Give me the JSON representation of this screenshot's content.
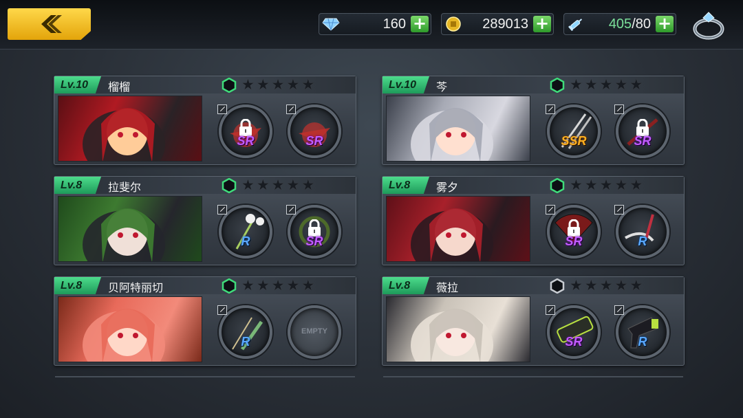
{
  "header": {
    "gems": "160",
    "gold": "289013",
    "stamina_current": "405",
    "stamina_max": "/80",
    "icons": {
      "back": "back-arrow-icon",
      "gems": "diamond-icon",
      "gold": "gold-coin-icon",
      "stamina": "syringe-icon",
      "settings": "ring-icon"
    }
  },
  "colors": {
    "accent_gold": "#f3c420",
    "level_green": "#3fcc80",
    "sr": "#c25cff",
    "ssr": "#ffb021",
    "r": "#5aa8ff"
  },
  "characters": [
    {
      "level": "Lv.10",
      "name": "榴榴",
      "grade_active": true,
      "stars": 5,
      "weapons": [
        {
          "rarity": "SR",
          "locked": true,
          "icon": "umbrella-icon"
        },
        {
          "rarity": "SR",
          "locked": false,
          "icon": "umbrella-icon"
        }
      ]
    },
    {
      "level": "Lv.10",
      "name": "芩",
      "grade_active": true,
      "stars": 5,
      "weapons": [
        {
          "rarity": "SSR",
          "locked": false,
          "icon": "twin-swords-icon"
        },
        {
          "rarity": "SR",
          "locked": true,
          "icon": "blade-icon"
        }
      ]
    },
    {
      "level": "Lv.8",
      "name": "拉斐尔",
      "grade_active": true,
      "stars": 5,
      "weapons": [
        {
          "rarity": "R",
          "locked": false,
          "icon": "flower-staff-icon"
        },
        {
          "rarity": "SR",
          "locked": true,
          "icon": "thorn-ring-icon"
        }
      ]
    },
    {
      "level": "Lv.8",
      "name": "雾夕",
      "grade_active": true,
      "stars": 5,
      "weapons": [
        {
          "rarity": "SR",
          "locked": true,
          "icon": "fan-icon"
        },
        {
          "rarity": "R",
          "locked": false,
          "icon": "chain-blade-icon"
        }
      ]
    },
    {
      "level": "Lv.8",
      "name": "贝阿特丽切",
      "grade_active": true,
      "stars": 5,
      "weapons": [
        {
          "rarity": "R",
          "locked": false,
          "icon": "sword-icon"
        },
        {
          "rarity": "",
          "locked": false,
          "empty": true,
          "empty_label": "EMPTY",
          "icon": "empty-slot-icon"
        }
      ]
    },
    {
      "level": "Lv.8",
      "name": "薇拉",
      "grade_active": false,
      "stars": 5,
      "weapons": [
        {
          "rarity": "SR",
          "locked": false,
          "icon": "death-bar-icon"
        },
        {
          "rarity": "R",
          "locked": false,
          "icon": "hair-dryer-icon"
        }
      ]
    }
  ]
}
